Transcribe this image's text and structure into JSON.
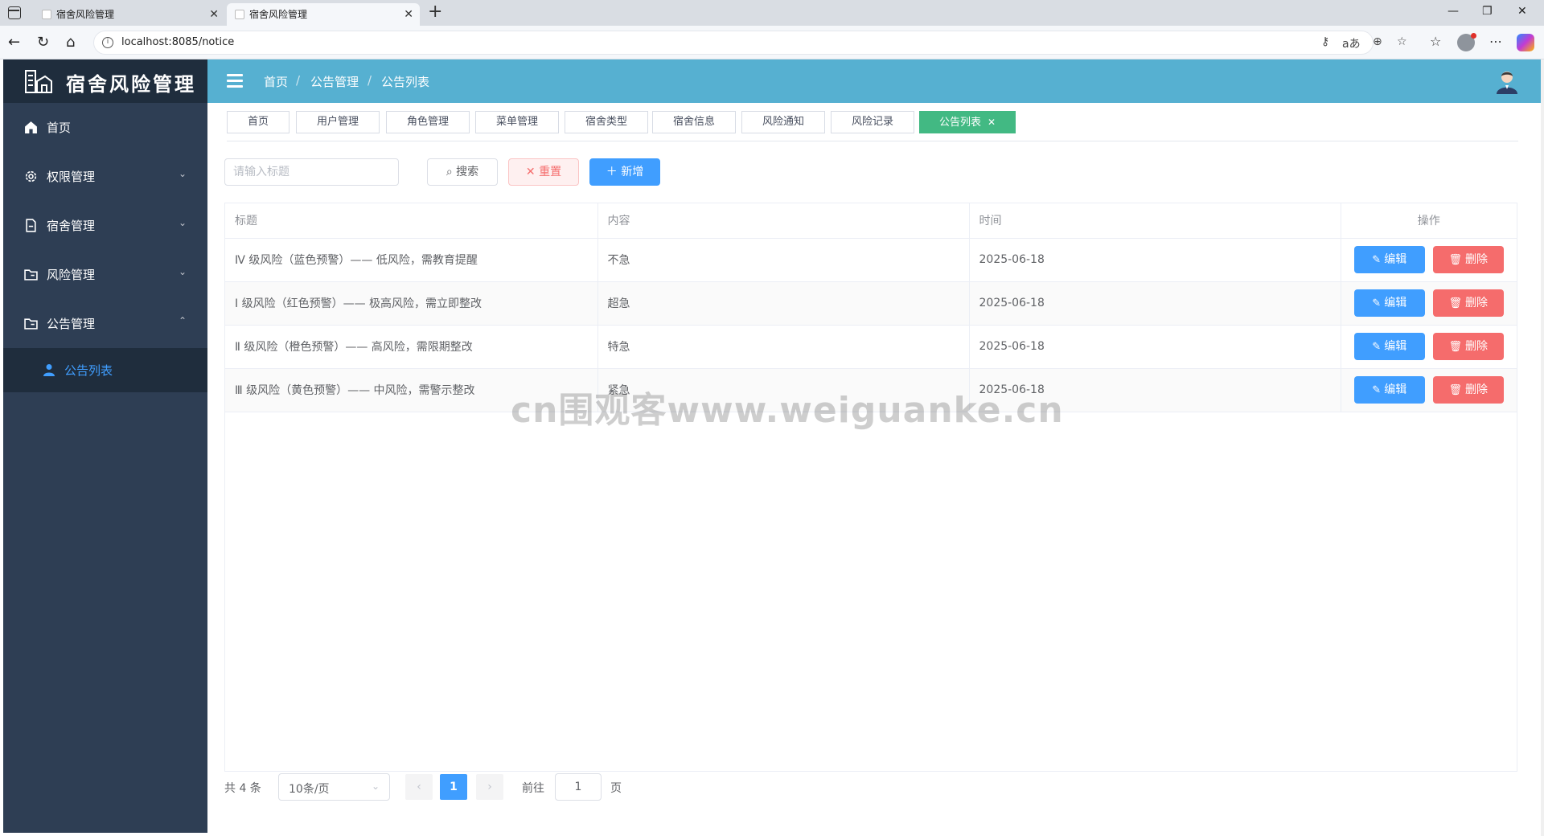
{
  "browser": {
    "tabs": [
      {
        "title": "宿舍风险管理",
        "active": false
      },
      {
        "title": "宿舍风险管理",
        "active": true
      }
    ],
    "url": "localhost:8085/notice"
  },
  "app": {
    "title": "宿舍风险管理"
  },
  "sidebar": {
    "items": [
      {
        "label": "首页",
        "icon": "home-icon",
        "has_arrow": false
      },
      {
        "label": "权限管理",
        "icon": "gear-icon",
        "has_arrow": true,
        "arrow": "⌄"
      },
      {
        "label": "宿舍管理",
        "icon": "document-icon",
        "has_arrow": true,
        "arrow": "⌄"
      },
      {
        "label": "风险管理",
        "icon": "folder-icon",
        "has_arrow": true,
        "arrow": "⌄"
      },
      {
        "label": "公告管理",
        "icon": "folder-icon",
        "has_arrow": true,
        "arrow": "⌃"
      }
    ],
    "submenu": {
      "label": "公告列表",
      "icon": "user-icon"
    }
  },
  "header": {
    "breadcrumb": [
      "首页",
      "公告管理",
      "公告列表"
    ]
  },
  "tags": [
    "首页",
    "用户管理",
    "角色管理",
    "菜单管理",
    "宿舍类型",
    "宿舍信息",
    "风险通知",
    "风险记录",
    "公告列表"
  ],
  "toolbar": {
    "search_placeholder": "请输入标题",
    "search_label": "搜索",
    "reset_label": "重置",
    "add_label": "新增"
  },
  "table": {
    "columns": [
      "标题",
      "内容",
      "时间",
      "操作"
    ],
    "edit_label": "编辑",
    "delete_label": "删除",
    "rows": [
      {
        "title": "Ⅳ 级风险（蓝色预警）—— 低风险，需教育提醒",
        "content": "不急",
        "time": "2025-06-18"
      },
      {
        "title": "Ⅰ 级风险（红色预警）—— 极高风险，需立即整改",
        "content": "超急",
        "time": "2025-06-18"
      },
      {
        "title": "Ⅱ 级风险（橙色预警）—— 高风险，需限期整改",
        "content": "特急",
        "time": "2025-06-18"
      },
      {
        "title": "Ⅲ 级风险（黄色预警）—— 中风险，需警示整改",
        "content": "紧急",
        "time": "2025-06-18"
      }
    ]
  },
  "pagination": {
    "total_label": "共 4 条",
    "page_size": "10条/页",
    "current_page": "1",
    "goto_label": "前往",
    "goto_value": "1",
    "page_suffix": "页"
  },
  "watermark": "cn围观客www.weiguanke.cn",
  "colors": {
    "sidebar_bg": "#2e3e54",
    "topbar_bg": "#56b0d1",
    "primary": "#409eff",
    "danger": "#f56c6c",
    "active_tag": "#42b983"
  }
}
